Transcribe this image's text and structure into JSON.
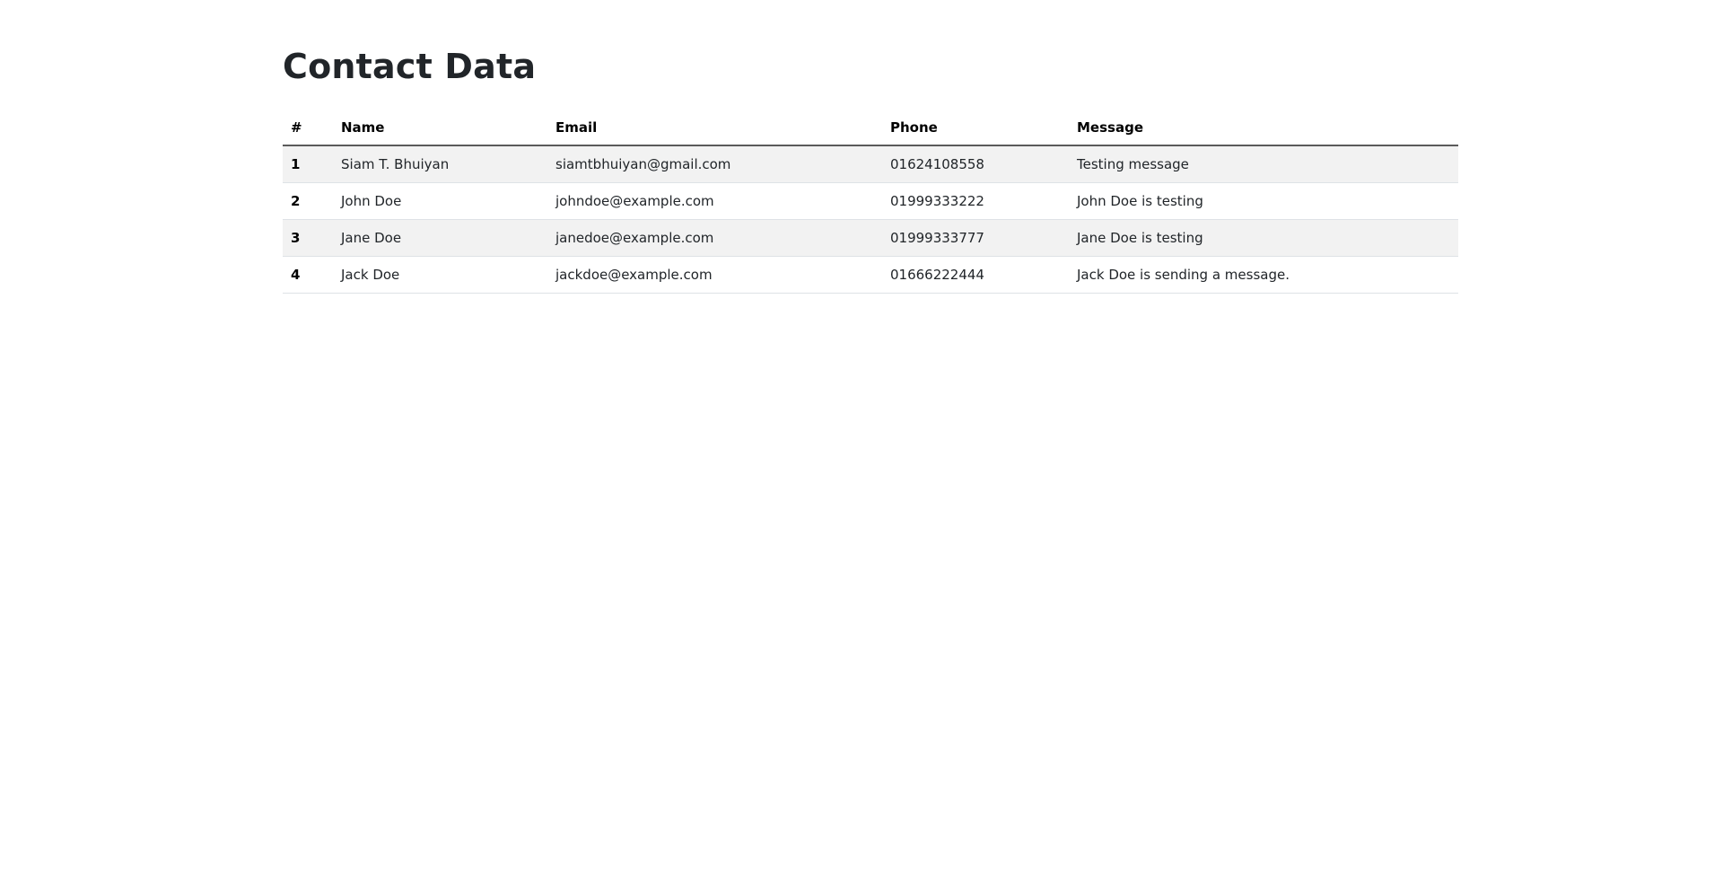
{
  "page": {
    "title": "Contact Data"
  },
  "table": {
    "headers": {
      "index": "#",
      "name": "Name",
      "email": "Email",
      "phone": "Phone",
      "message": "Message"
    },
    "rows": [
      {
        "index": "1",
        "name": "Siam T. Bhuiyan",
        "email": "siamtbhuiyan@gmail.com",
        "phone": "01624108558",
        "message": "Testing message"
      },
      {
        "index": "2",
        "name": "John Doe",
        "email": "johndoe@example.com",
        "phone": "01999333222",
        "message": "John Doe is testing"
      },
      {
        "index": "3",
        "name": "Jane Doe",
        "email": "janedoe@example.com",
        "phone": "01999333777",
        "message": "Jane Doe is testing"
      },
      {
        "index": "4",
        "name": "Jack Doe",
        "email": "jackdoe@example.com",
        "phone": "01666222444",
        "message": "Jack Doe is sending a message."
      }
    ]
  },
  "colors": {
    "text": "#212529",
    "header_border": "#5b5b5b",
    "stripe": "#f2f2f2",
    "row_border": "#dee2e6"
  }
}
